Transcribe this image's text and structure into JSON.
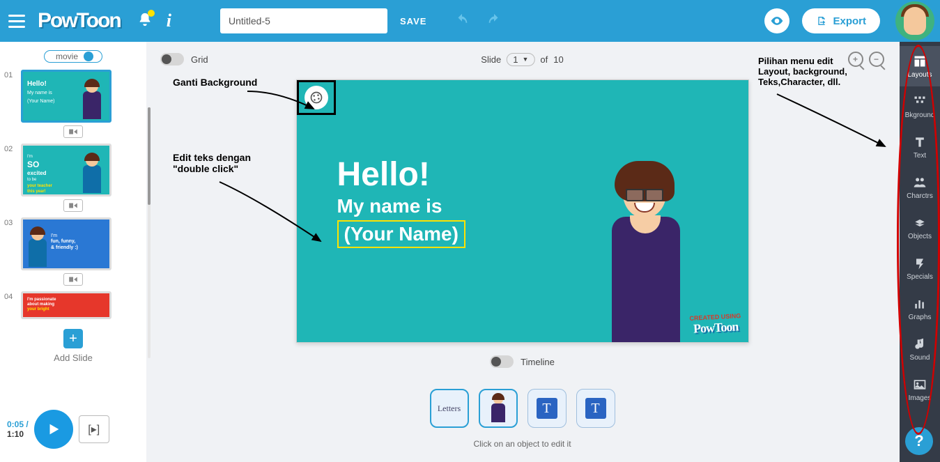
{
  "header": {
    "logo": "PowToon",
    "title_value": "Untitled-5",
    "save": "SAVE",
    "export": "Export"
  },
  "slides_panel": {
    "mode": "movie",
    "slides": [
      {
        "num": "01",
        "line1": "Hello!",
        "line2": "My name is",
        "line3": "(Your Name)",
        "bg": "#1fb6b6",
        "body": "#3a2568"
      },
      {
        "num": "02",
        "line1": "I'm",
        "line2": "SO",
        "line3": "excited",
        "line4": "to be",
        "line5": "your teacher",
        "line6": "this year!",
        "bg": "#1fb6b6",
        "body": "#0f6ea8"
      },
      {
        "num": "03",
        "line1": "I'm",
        "line2": "fun, funny,",
        "line3": "& friendly :)",
        "bg": "#2a78d4",
        "body": "#0f6ea8"
      },
      {
        "num": "04",
        "line1": "I'm passionate",
        "line2": "about making",
        "line3": "your bright",
        "bg": "#e6372b",
        "body": ""
      }
    ],
    "add_slide": "Add Slide"
  },
  "playbar": {
    "current": "0:05",
    "sep": "/",
    "duration": "1:10"
  },
  "center": {
    "grid_label": "Grid",
    "slide_word": "Slide",
    "slide_current": "1",
    "slide_of": "of",
    "slide_total": "10",
    "timeline_label": "Timeline",
    "obj_buttons": [
      "Letters",
      "character",
      "T",
      "T"
    ],
    "hint": "Click on an object to edit it"
  },
  "canvas": {
    "hello": "Hello!",
    "myname": "My name is",
    "yourname": "(Your Name)",
    "watermark_top": "CREATED USING",
    "watermark_logo": "PowToon"
  },
  "right_tools": [
    {
      "label": "Layouts",
      "icon": "layouts"
    },
    {
      "label": "Bkground",
      "icon": "bkground"
    },
    {
      "label": "Text",
      "icon": "text"
    },
    {
      "label": "Charctrs",
      "icon": "char"
    },
    {
      "label": "Objects",
      "icon": "obj"
    },
    {
      "label": "Specials",
      "icon": "spec"
    },
    {
      "label": "Graphs",
      "icon": "graph"
    },
    {
      "label": "Sound",
      "icon": "sound"
    },
    {
      "label": "Images",
      "icon": "img"
    }
  ],
  "annotations": {
    "ganti": "Ganti Background",
    "edit1": "Edit teks dengan",
    "edit2": "\"double click\"",
    "menu1": "Pilihan menu edit",
    "menu2": "Layout, background,",
    "menu3": "Teks,Character, dll."
  }
}
